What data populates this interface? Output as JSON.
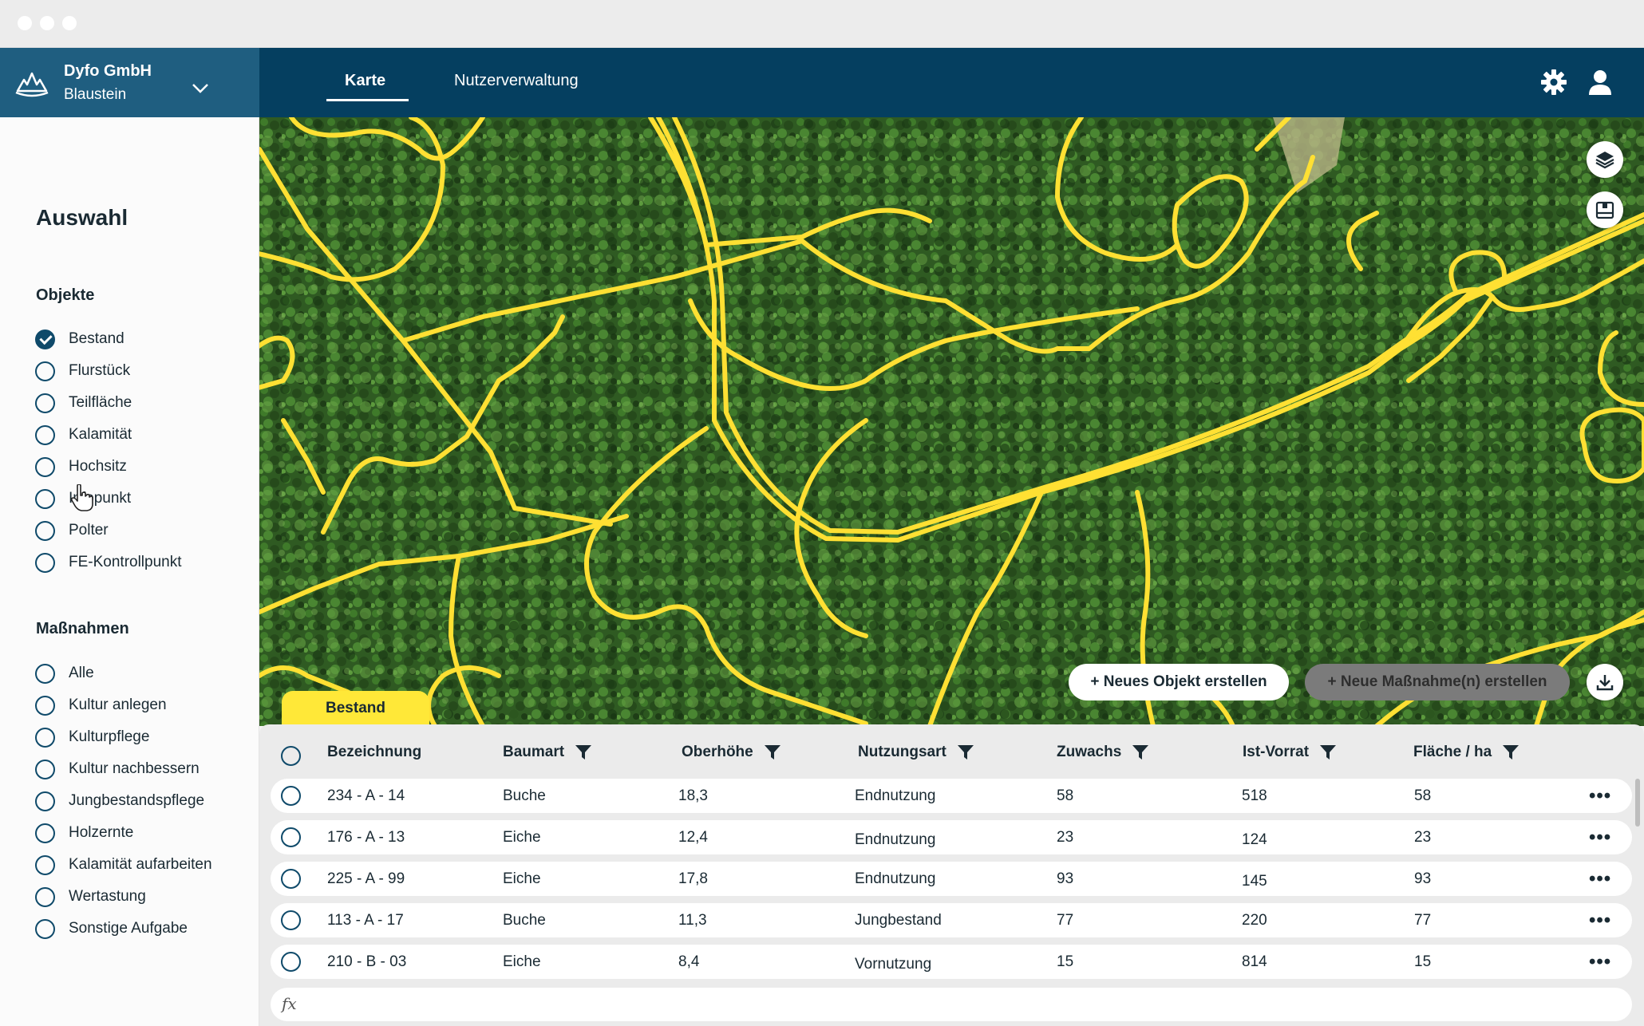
{
  "header": {
    "company": "Dyfo GmbH",
    "location": "Blaustein",
    "tabs": [
      {
        "label": "Karte",
        "active": true
      },
      {
        "label": "Nutzerverwaltung",
        "active": false
      }
    ],
    "icons": [
      "gear-icon",
      "user-icon"
    ]
  },
  "sidebar": {
    "title": "Auswahl",
    "objects_title": "Objekte",
    "objects": [
      {
        "label": "Bestand",
        "checked": true
      },
      {
        "label": "Flurstück",
        "checked": false
      },
      {
        "label": "Teilfläche",
        "checked": false
      },
      {
        "label": "Kalamität",
        "checked": false
      },
      {
        "label": "Hochsitz",
        "checked": false
      },
      {
        "label": "Infopunkt",
        "checked": false
      },
      {
        "label": "Polter",
        "checked": false
      },
      {
        "label": "FE-Kontrollpunkt",
        "checked": false
      }
    ],
    "measures_title": "Maßnahmen",
    "measures": [
      {
        "label": "Alle",
        "checked": false
      },
      {
        "label": "Kultur anlegen",
        "checked": false
      },
      {
        "label": "Kulturpflege",
        "checked": false
      },
      {
        "label": "Kultur nachbessern",
        "checked": false
      },
      {
        "label": "Jungbestandspflege",
        "checked": false
      },
      {
        "label": "Holzernte",
        "checked": false
      },
      {
        "label": "Kalamität aufarbeiten",
        "checked": false
      },
      {
        "label": "Wertastung",
        "checked": false
      },
      {
        "label": "Sonstige Aufgabe",
        "checked": false
      }
    ]
  },
  "map": {
    "new_object_button": "+ Neues Objekt erstellen",
    "new_measure_button": "+ Neue Maßnahme(n) erstellen",
    "layer_icon": "layers-icon",
    "legend_icon": "map-legend-icon",
    "download_icon": "download-icon",
    "boundary_color": "#ffe033",
    "forest_color": "#2f5a22"
  },
  "table": {
    "tab_label": "Bestand",
    "columns": [
      "Bezeichnung",
      "Baumart",
      "Oberhöhe",
      "Nutzungsart",
      "Zuwachs",
      "Ist-Vorrat",
      "Fläche / ha"
    ],
    "rows": [
      [
        "234 -  A - 14",
        "Buche",
        "18,3",
        "Endnutzung",
        "58",
        "518",
        "58"
      ],
      [
        "176 - A - 13",
        "Eiche",
        "12,4",
        "Endnutzung",
        "23",
        "124",
        "23"
      ],
      [
        "225 - A - 99",
        "Eiche",
        "17,8",
        "Endnutzung",
        "93",
        "145",
        "93"
      ],
      [
        "113 - A - 17",
        "Buche",
        "11,3",
        "Jungbestand",
        "77",
        "220",
        "77"
      ],
      [
        "210 - B - 03",
        "Eiche",
        "8,4",
        "Vornutzung",
        "15",
        "814",
        "15"
      ]
    ],
    "row_menu": "•••",
    "formula_symbol": "fx"
  }
}
